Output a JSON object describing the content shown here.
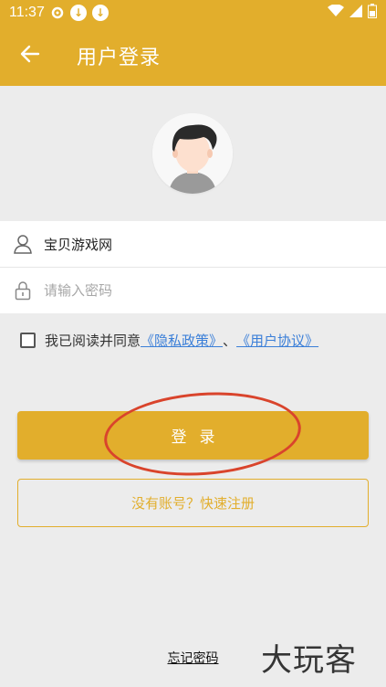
{
  "status_bar": {
    "time": "11:37",
    "icons_left": [
      "settings-gear-icon",
      "download-icon",
      "download-icon"
    ],
    "icons_right": [
      "wifi-icon",
      "signal-icon",
      "battery-icon"
    ]
  },
  "app_bar": {
    "title": "用户登录",
    "back_icon": "arrow-left-icon",
    "color": "#e2ae2c"
  },
  "form": {
    "username": {
      "value": "宝贝游戏网",
      "placeholder": ""
    },
    "password": {
      "value": "",
      "placeholder": "请输入密码"
    }
  },
  "agreement": {
    "checked": false,
    "prefix": "我已阅读并同意",
    "privacy_link": "《隐私政策》",
    "separator": "、",
    "user_link": "《用户协议》"
  },
  "buttons": {
    "login": "登录",
    "register": "没有账号？快速注册",
    "forgot": "忘记密码"
  },
  "watermark": "大玩客",
  "colors": {
    "accent": "#e2ae2c",
    "link": "#3b7fd8",
    "annotation": "#d9442c"
  }
}
